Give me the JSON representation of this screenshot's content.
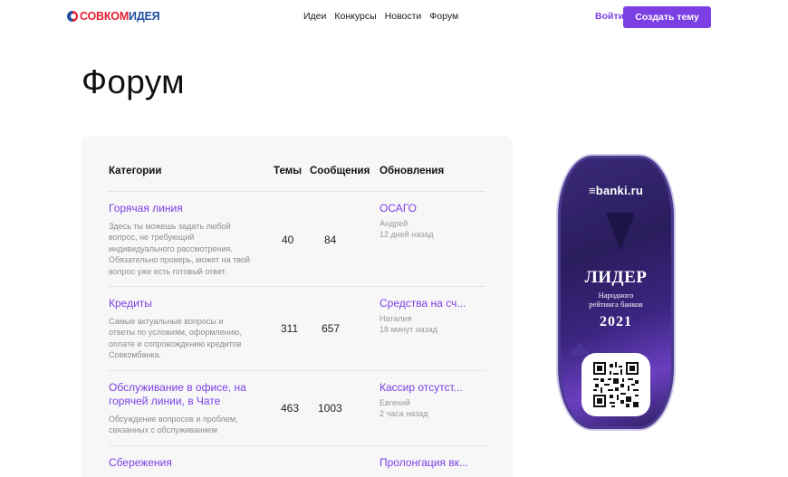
{
  "header": {
    "logo": {
      "part1": "СОВКОМ",
      "part2": "ИДЕЯ"
    },
    "nav": [
      "Идеи",
      "Конкурсы",
      "Новости",
      "Форум"
    ],
    "login": "Войти",
    "create": "Создать тему"
  },
  "page_title": "Форум",
  "table": {
    "headers": {
      "category": "Категории",
      "topics": "Темы",
      "messages": "Сообщения",
      "updates": "Обновления"
    },
    "rows": [
      {
        "title": [
          "Горячая линия"
        ],
        "desc": [
          "Здесь ты можешь задать любой",
          "вопрос, не требующий",
          "индивидуального рассмотрения.",
          "Обязательно проверь, может на твой",
          "вопрос уже есть готовый ответ."
        ],
        "topics": "40",
        "messages": "84",
        "update_title": "ОСАГО",
        "update_author": "Андрей",
        "update_time": "12 дней назад"
      },
      {
        "title": [
          "Кредиты"
        ],
        "desc": [
          "Самые актуальные вопросы и",
          "ответы по условиям, оформлению,",
          "оплате и сопровождению кредитов",
          "Совкомбанка."
        ],
        "topics": "311",
        "messages": "657",
        "update_title": "Средства на сч...",
        "update_author": "Наталия",
        "update_time": "18 минут назад"
      },
      {
        "title": [
          "Обслуживание в офисе, на",
          "горячей линии, в Чате"
        ],
        "desc": [
          "Обсуждение вопросов и проблем,",
          "связанных с обслуживанием"
        ],
        "topics": "463",
        "messages": "1003",
        "update_title": "Кассир отсутст...",
        "update_author": "Евгений",
        "update_time": "2 часа назад"
      },
      {
        "title": [
          "Сбережения"
        ],
        "desc": [],
        "topics": "",
        "messages": "",
        "update_title": "Пролонгация вк...",
        "update_author": "",
        "update_time": ""
      }
    ]
  },
  "badge": {
    "brand": "≡banki.ru",
    "leader": "ЛИДЕР",
    "sub1": "Народного",
    "sub2": "рейтинга банков",
    "year": "2021"
  },
  "colors": {
    "accent": "#7b3fe4",
    "logo_red": "#e4202f",
    "logo_blue": "#1f4f9e",
    "card_bg": "#f7f7f8",
    "badge_bg": "#2a1d5c"
  }
}
